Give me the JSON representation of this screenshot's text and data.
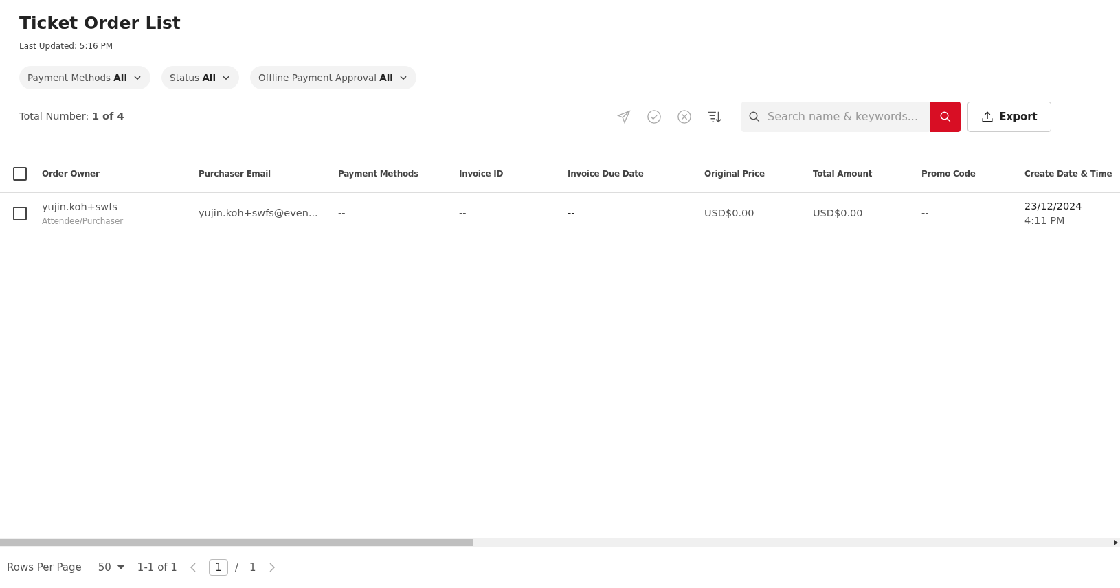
{
  "title": "Ticket Order List",
  "last_updated": "Last Updated: 5:16 PM",
  "filters": [
    {
      "label": "Payment Methods",
      "value": "All"
    },
    {
      "label": "Status",
      "value": "All"
    },
    {
      "label": "Offline Payment Approval",
      "value": "All"
    }
  ],
  "total": "Total Number: **1 of 4**",
  "search": {
    "placeholder": "Search name & keywords..."
  },
  "export_label": "Export",
  "table": {
    "select_all": {
      "checked": false
    },
    "columns": [
      "Order Owner",
      "Purchaser Email",
      "Payment Methods",
      "Invoice ID",
      "Invoice Due Date",
      "Original Price",
      "Total Amount",
      "Promo Code",
      "Create Date & Time"
    ],
    "rows": [
      {
        "checked": false,
        "owner": "yujin.koh+swfs",
        "role": "Attendee/Purchaser",
        "email": "yujin.koh+swfs@even...",
        "payment_methods": "--",
        "invoice_id": "--",
        "invoice_due_date": "--",
        "original_price": "USD$0.00",
        "total_amount": "USD$0.00",
        "promo_code": "--",
        "create_date": "23/12/2024",
        "create_time": "4:11 PM"
      }
    ]
  },
  "pagination": {
    "rows_per_page_label": "Rows Per Page",
    "rows_per_page": "50",
    "range": "1-1 of 1",
    "page": "1",
    "separator": "/",
    "pages": "1"
  }
}
